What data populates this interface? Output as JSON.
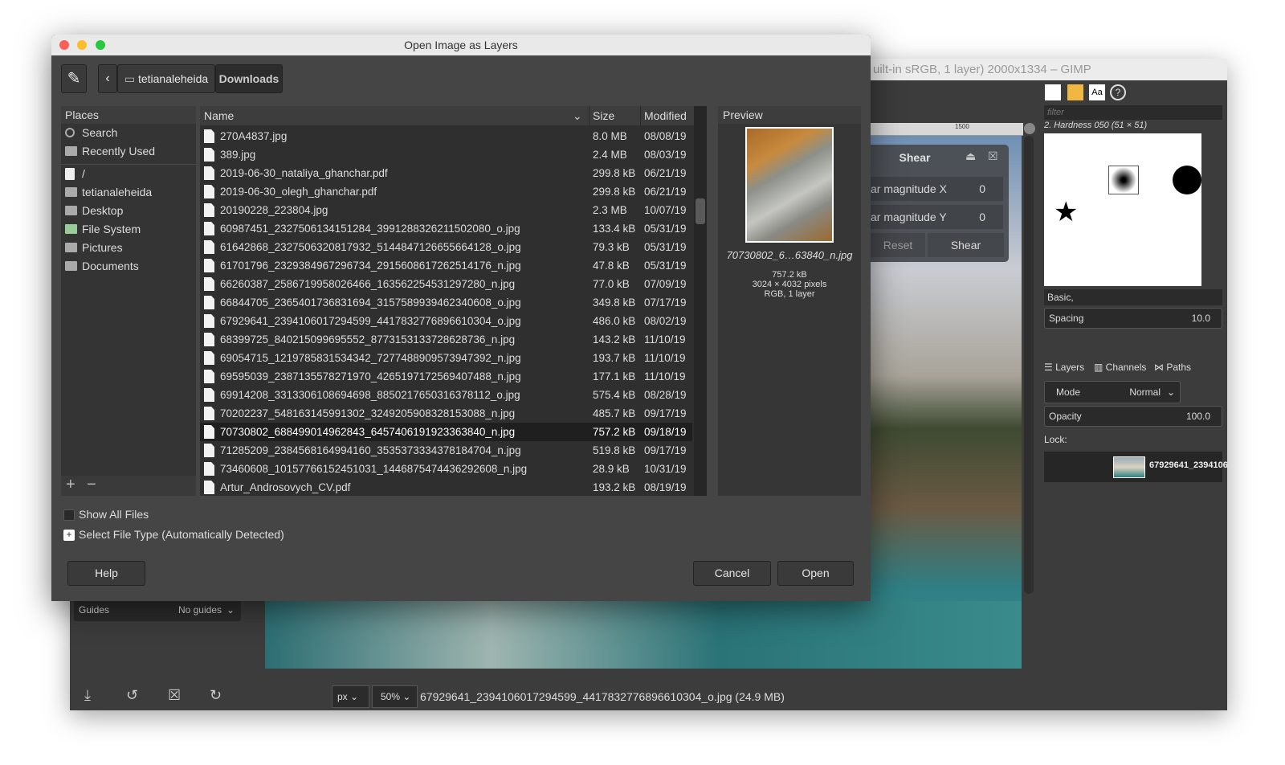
{
  "gimp": {
    "title": "uilt-in sRGB, 1 layer) 2000x1334 – GIMP",
    "shear": {
      "title": "Shear",
      "x_label": "ar magnitude X",
      "x_value": "0",
      "y_label": "ar magnitude Y",
      "y_value": "0",
      "reset": "Reset",
      "shear": "Shear"
    },
    "ruler_label": "1500",
    "guides_label": "Guides",
    "guides_value": "No guides",
    "unit": "px",
    "zoom": "50%",
    "status": "67929641_2394106017294599_4417832776896610304_o.jpg (24.9 MB)",
    "dock": {
      "filter_placeholder": "filter",
      "brush_name": "2. Hardness 050 (51 × 51)",
      "brush_tag": "Basic,",
      "spacing_label": "Spacing",
      "spacing_value": "10.0",
      "tabs": [
        "Layers",
        "Channels",
        "Paths"
      ],
      "mode_label": "Mode",
      "mode_value": "Normal",
      "opacity_label": "Opacity",
      "opacity_value": "100.0",
      "lock_label": "Lock:",
      "layer_name": "67929641_2394106"
    }
  },
  "dialog": {
    "title": "Open Image as Layers",
    "path": [
      "tetianaleheida",
      "Downloads"
    ],
    "places_header": "Places",
    "places": [
      "Search",
      "Recently Used",
      "/",
      "tetianaleheida",
      "Desktop",
      "File System",
      "Pictures",
      "Documents"
    ],
    "columns": {
      "name": "Name",
      "size": "Size",
      "modified": "Modified"
    },
    "files": [
      {
        "name": "270A4837.jpg",
        "size": "8.0 MB",
        "modified": "08/08/19"
      },
      {
        "name": "389.jpg",
        "size": "2.4 MB",
        "modified": "08/03/19"
      },
      {
        "name": "2019-06-30_nataliya_ghanchar.pdf",
        "size": "299.8 kB",
        "modified": "06/21/19"
      },
      {
        "name": "2019-06-30_olegh_ghanchar.pdf",
        "size": "299.8 kB",
        "modified": "06/21/19"
      },
      {
        "name": "20190228_223804.jpg",
        "size": "2.3 MB",
        "modified": "10/07/19"
      },
      {
        "name": "60987451_2327506134151284_3991288326211502080_o.jpg",
        "size": "133.4 kB",
        "modified": "05/31/19"
      },
      {
        "name": "61642868_2327506320817932_5144847126655664128_o.jpg",
        "size": "79.3 kB",
        "modified": "05/31/19"
      },
      {
        "name": "61701796_2329384967296734_2915608617262514176_n.jpg",
        "size": "47.8 kB",
        "modified": "05/31/19"
      },
      {
        "name": "66260387_2586719958026466_1635622545312972​80_n.jpg",
        "size": "77.0 kB",
        "modified": "07/09/19"
      },
      {
        "name": "66844705_2365401736831694_3157589939462340608_o.jpg",
        "size": "349.8 kB",
        "modified": "07/17/19"
      },
      {
        "name": "67929641_2394106017294599_4417832776896610304_o.jpg",
        "size": "486.0 kB",
        "modified": "08/02/19"
      },
      {
        "name": "68399725_840215099695552_8773153133728628736_n.jpg",
        "size": "143.2 kB",
        "modified": "11/10/19"
      },
      {
        "name": "69054715_1219785831534342_7277488909573947392_n.jpg",
        "size": "193.7 kB",
        "modified": "11/10/19"
      },
      {
        "name": "69595039_2387135578271970_4265197172569407488_n.jpg",
        "size": "177.1 kB",
        "modified": "11/10/19"
      },
      {
        "name": "69914208_3313306108694698_8850217650316378112_o.jpg",
        "size": "575.4 kB",
        "modified": "08/28/19"
      },
      {
        "name": "70202237_548163145991302_3249205908328153088_n.jpg",
        "size": "485.7 kB",
        "modified": "09/17/19"
      },
      {
        "name": "70730802_688499014962843_6457406191923363840_n.jpg",
        "size": "757.2 kB",
        "modified": "09/18/19",
        "selected": true
      },
      {
        "name": "71285209_2384568164994160_3535373334378184704_n.jpg",
        "size": "519.8 kB",
        "modified": "09/17/19"
      },
      {
        "name": "73460608_10157766152451031_1446875474436292608_n.jpg",
        "size": "28.9 kB",
        "modified": "10/31/19"
      },
      {
        "name": "Artur_Androsovych_CV.pdf",
        "size": "193.2 kB",
        "modified": "08/19/19"
      }
    ],
    "preview": {
      "header": "Preview",
      "filename": "70730802_6…63840_n.jpg",
      "size": "757.2 kB",
      "dimensions": "3024 × 4032 pixels",
      "info": "RGB, 1 layer"
    },
    "show_all_files": "Show All Files",
    "file_type": "Select File Type (Automatically Detected)",
    "help": "Help",
    "cancel": "Cancel",
    "open": "Open"
  }
}
